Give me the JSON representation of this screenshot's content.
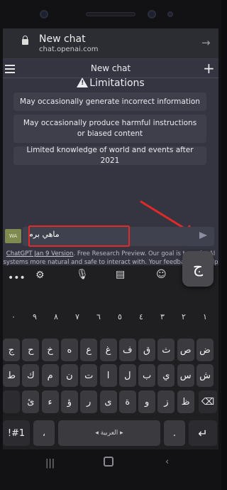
{
  "browser": {
    "title": "New chat",
    "host": "chat.openai.com"
  },
  "chat": {
    "header_title": "New chat",
    "limitations_heading": "Limitations",
    "limitations": [
      "May occasionally generate incorrect information",
      "May occasionally produce harmful instructions or biased content",
      "Limited knowledge of world and events after 2021"
    ],
    "avatar": "WA",
    "input_value": "ماهي برم",
    "footer_link": "ChatGPT Jan 9 Version",
    "footer_text": ". Free Research Preview. Our goal is to make AI systems more natural and safe to interact with. Your feedback will help us improve."
  },
  "keyboard": {
    "language": "العربية",
    "popup_key": "ج",
    "symbols_key": "!#1",
    "number_row": [
      "١",
      "٢",
      "٣",
      "٤",
      "٥",
      "٦",
      "٧",
      "٨",
      "٩",
      "٠"
    ],
    "row1": [
      "ض",
      "ص",
      "ث",
      "ق",
      "ف",
      "غ",
      "ع",
      "ه",
      "خ",
      "ح",
      "ج"
    ],
    "row2": [
      "ش",
      "س",
      "ي",
      "ب",
      "ل",
      "ا",
      "ت",
      "ن",
      "م",
      "ك",
      "ط"
    ],
    "row3": [
      "ظ",
      "ز",
      "و",
      "ة",
      "ى",
      "ر",
      "ؤ",
      "ء",
      "ئ"
    ],
    "comma": "،",
    "period": "."
  },
  "colors": {
    "highlight_red": "#e02a2a",
    "screen_bg": "#343541",
    "card_bg": "#3e3f4b"
  }
}
